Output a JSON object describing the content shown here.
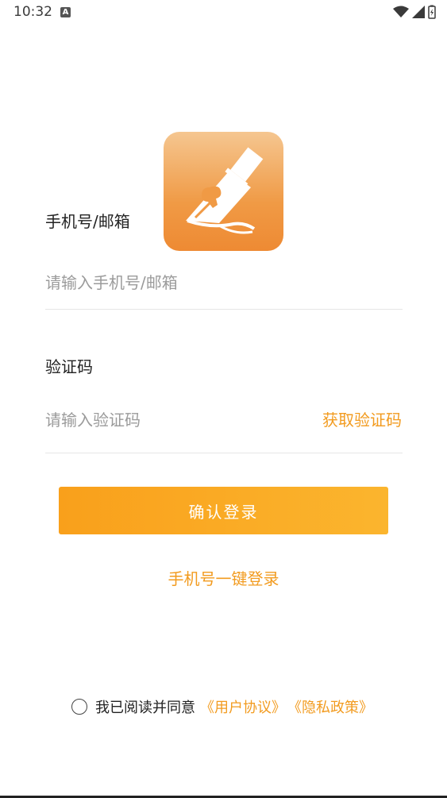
{
  "status": {
    "time": "10:32",
    "icon_a": "A"
  },
  "form": {
    "phone_label": "手机号/邮箱",
    "phone_placeholder": "请输入手机号/邮箱",
    "code_label": "验证码",
    "code_placeholder": "请输入验证码",
    "get_code_label": "获取验证码",
    "confirm_label": "确认登录",
    "onekey_label": "手机号一键登录"
  },
  "agreement": {
    "text": "我已阅读并同意",
    "user_agreement": "《用户协议》",
    "privacy_policy": "《隐私政策》",
    "checked": false
  },
  "colors": {
    "accent": "#f29b1f",
    "button_start": "#f9a01b",
    "button_end": "#fbb52e"
  },
  "icons": [
    "wifi-icon",
    "signal-icon",
    "battery-icon",
    "app-logo-pen-icon",
    "radio-unchecked-icon"
  ]
}
